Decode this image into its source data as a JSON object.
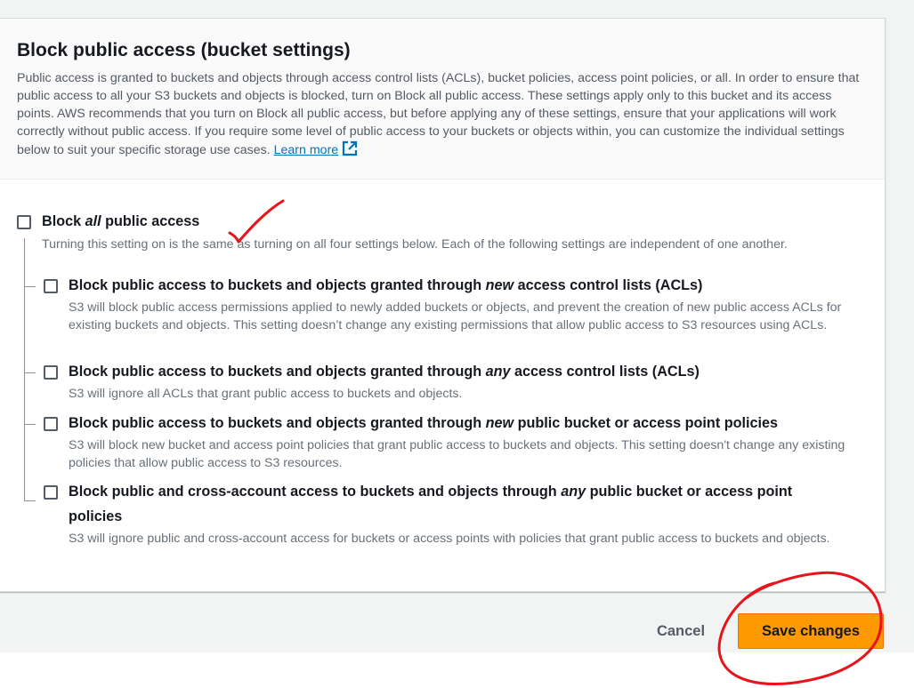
{
  "section": {
    "title": "Block public access (bucket settings)",
    "description": "Public access is granted to buckets and objects through access control lists (ACLs), bucket policies, access point policies, or all. In order to ensure that public access to all your S3 buckets and objects is blocked, turn on Block all public access. These settings apply only to this bucket and its access points. AWS recommends that you turn on Block all public access, but before applying any of these settings, ensure that your applications will work correctly without public access. If you require some level of public access to your buckets or objects within, you can customize the individual settings below to suit your specific storage use cases.",
    "learn_more": "Learn more",
    "learn_more_icon": "external-link-icon"
  },
  "block_all": {
    "label_pre": "Block ",
    "label_em": "all",
    "label_post": " public access",
    "description": "Turning this setting on is the same as turning on all four settings below. Each of the following settings are independent of one another.",
    "checked": false
  },
  "options": [
    {
      "label_pre": "Block public access to buckets and objects granted through ",
      "label_em": "new",
      "label_post": " access control lists (ACLs)",
      "description": "S3 will block public access permissions applied to newly added buckets or objects, and prevent the creation of new public access ACLs for existing buckets and objects. This setting doesn’t change any existing permissions that allow public access to S3 resources using ACLs.",
      "checked": false
    },
    {
      "label_pre": "Block public access to buckets and objects granted through ",
      "label_em": "any",
      "label_post": " access control lists (ACLs)",
      "description": "S3 will ignore all ACLs that grant public access to buckets and objects.",
      "checked": false
    },
    {
      "label_pre": "Block public access to buckets and objects granted through ",
      "label_em": "new",
      "label_post": " public bucket or access point policies",
      "description": "S3 will block new bucket and access point policies that grant public access to buckets and objects. This setting doesn't change any existing policies that allow public access to S3 resources.",
      "checked": false
    },
    {
      "label_pre": "Block public and cross-account access to buckets and objects through ",
      "label_em": "any",
      "label_post": " public bucket or access point",
      "label_line2": "policies",
      "description": "S3 will ignore public and cross-account access for buckets or access points with policies that grant public access to buckets and objects.",
      "checked": false
    }
  ],
  "footer": {
    "cancel_label": "Cancel",
    "save_label": "Save changes"
  },
  "colors": {
    "primary_button": "#ff9900",
    "link": "#0073bb",
    "annotation": "#e8141c"
  }
}
